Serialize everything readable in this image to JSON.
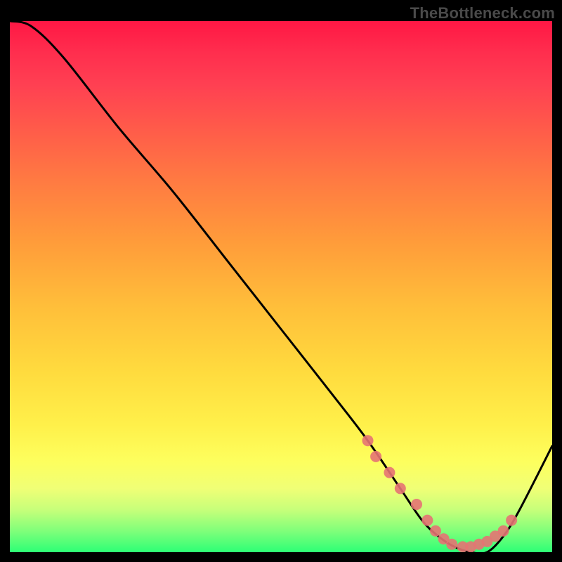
{
  "watermark": "TheBottleneck.com",
  "chart_data": {
    "type": "line",
    "title": "",
    "xlabel": "",
    "ylabel": "",
    "xlim": [
      0,
      100
    ],
    "ylim": [
      0,
      100
    ],
    "x": [
      0,
      4,
      10,
      20,
      30,
      40,
      50,
      60,
      66,
      72,
      76,
      79,
      82,
      85,
      88,
      91,
      94,
      100
    ],
    "values": [
      100,
      99,
      93,
      80,
      68,
      55,
      42,
      29,
      21,
      12,
      6,
      3,
      1,
      0,
      0,
      3,
      8,
      20
    ],
    "markers": {
      "x": [
        66,
        67.5,
        70,
        72,
        75,
        77,
        78.5,
        80,
        81.5,
        83.5,
        85,
        86.5,
        88,
        89.5,
        91,
        92.5
      ],
      "values": [
        21,
        18,
        15,
        12,
        9,
        6,
        4,
        2.5,
        1.5,
        1,
        1,
        1.5,
        2,
        3,
        4,
        6
      ]
    },
    "gradient_stops": [
      {
        "pos": 0.0,
        "color": "#ff1744"
      },
      {
        "pos": 0.3,
        "color": "#ff7a42"
      },
      {
        "pos": 0.66,
        "color": "#ffdb3e"
      },
      {
        "pos": 0.88,
        "color": "#f0ff76"
      },
      {
        "pos": 1.0,
        "color": "#2dff76"
      }
    ]
  }
}
